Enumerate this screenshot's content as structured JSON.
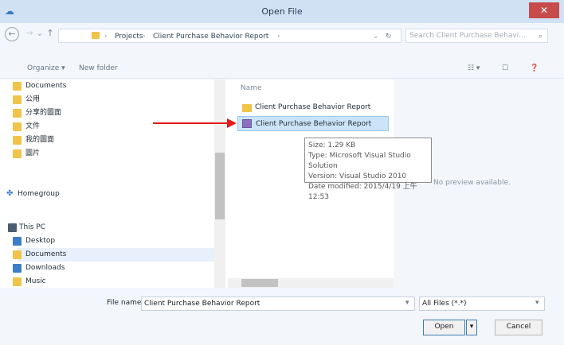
{
  "window": {
    "title": "Open File",
    "close_glyph": "✕"
  },
  "nav": {
    "back": "←",
    "forward": "→",
    "dropdown": "⌄",
    "up": "↑"
  },
  "address": {
    "sep": "›",
    "crumbs": [
      "Projects",
      "Client Purchase Behavior Report"
    ],
    "dropdown": "⌄",
    "refresh": "↻"
  },
  "search": {
    "placeholder": "Search Client Purchase Behavi...",
    "icon": "⌕"
  },
  "toolbar": {
    "organize": "Organize ▾",
    "new_folder": "New folder",
    "view_glyph": "☷ ▾",
    "pane_glyph": "☐",
    "help_glyph": "❓"
  },
  "sidebar": {
    "items": [
      {
        "label": "Documents",
        "icon_color": "#f0c44a"
      },
      {
        "label": "公用",
        "icon_color": "#f0c44a"
      },
      {
        "label": "分享的圖面",
        "icon_color": "#f0c44a"
      },
      {
        "label": "文件",
        "icon_color": "#f0c44a"
      },
      {
        "label": "我的圖面",
        "icon_color": "#f0c44a"
      },
      {
        "label": "圖片",
        "icon_color": "#f0c44a"
      }
    ],
    "homegroup": "Homegroup",
    "thispc": "This PC",
    "pc_items": [
      {
        "label": "Desktop",
        "icon_color": "#3b7ec7"
      },
      {
        "label": "Documents",
        "icon_color": "#f0c44a"
      },
      {
        "label": "Downloads",
        "icon_color": "#3b7ec7"
      },
      {
        "label": "Music",
        "icon_color": "#f0c44a"
      }
    ]
  },
  "files": {
    "column": "Name",
    "items": [
      {
        "name": "Client Purchase Behavior Report",
        "kind": "folder"
      },
      {
        "name": "Client Purchase Behavior Report",
        "kind": "solution"
      }
    ]
  },
  "tooltip": {
    "lines": [
      "Size: 1.29 KB",
      "Type: Microsoft Visual Studio Solution",
      "Version: Visual Studio 2010",
      "Date modified: 2015/4/19 上午 12:53"
    ]
  },
  "preview": {
    "message": "No preview available."
  },
  "bottom": {
    "filename_label": "File name:",
    "filename_value": "Client Purchase Behavior Report",
    "filetype_value": "All Files (*.*)",
    "open_label": "Open",
    "open_dropdown": "▾",
    "cancel_label": "Cancel"
  },
  "colors": {
    "accent": "#cce4f7",
    "arrow": "#e21b1b",
    "close": "#c74b4b"
  }
}
